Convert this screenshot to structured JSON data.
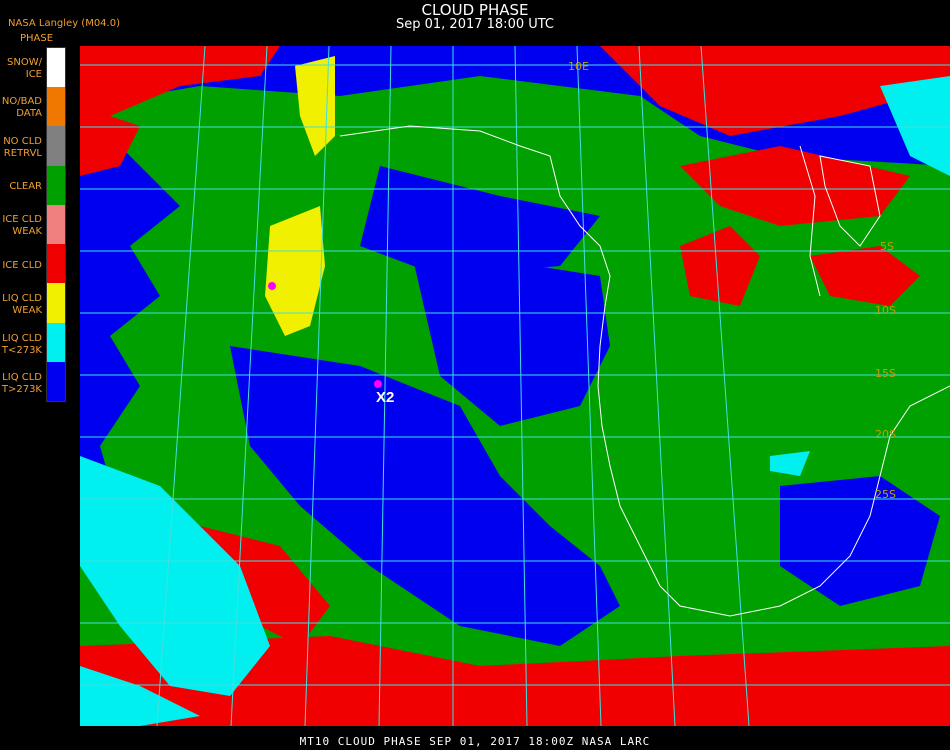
{
  "header": {
    "title": "CLOUD PHASE",
    "datetime": "Sep 01, 2017 18:00 UTC",
    "producer": "NASA Langley (M04.0)"
  },
  "legend": {
    "title": "PHASE",
    "items": [
      {
        "label": "SNOW/\nICE",
        "color": "#ffffff"
      },
      {
        "label": "NO/BAD\nDATA",
        "color": "#f07800"
      },
      {
        "label": "NO CLD\nRETRVL",
        "color": "#808080"
      },
      {
        "label": "CLEAR",
        "color": "#00a000"
      },
      {
        "label": "ICE CLD\nWEAK",
        "color": "#f08080"
      },
      {
        "label": "ICE CLD",
        "color": "#f00000"
      },
      {
        "label": "LIQ CLD\nWEAK",
        "color": "#f0f000"
      },
      {
        "label": "LIQ CLD\nT<273K",
        "color": "#00f0f0"
      },
      {
        "label": "LIQ CLD\nT>273K",
        "color": "#0000f0"
      }
    ]
  },
  "map": {
    "marker_label": "X2",
    "lat_labels": [
      "5S",
      "10S",
      "15S",
      "20S",
      "25S"
    ],
    "lon_labels": [
      "10E"
    ]
  },
  "footer": {
    "text": "MT10  CLOUD PHASE  SEP 01, 2017 18:00Z  NASA LARC"
  },
  "colors": {
    "clear": "#00a000",
    "liq_warm": "#0000f0",
    "liq_cold": "#00f0f0",
    "liq_weak": "#f0f000",
    "ice": "#f00000",
    "grid": "#40e0e0",
    "coast": "#ffffff",
    "marker": "#ff00ff"
  }
}
